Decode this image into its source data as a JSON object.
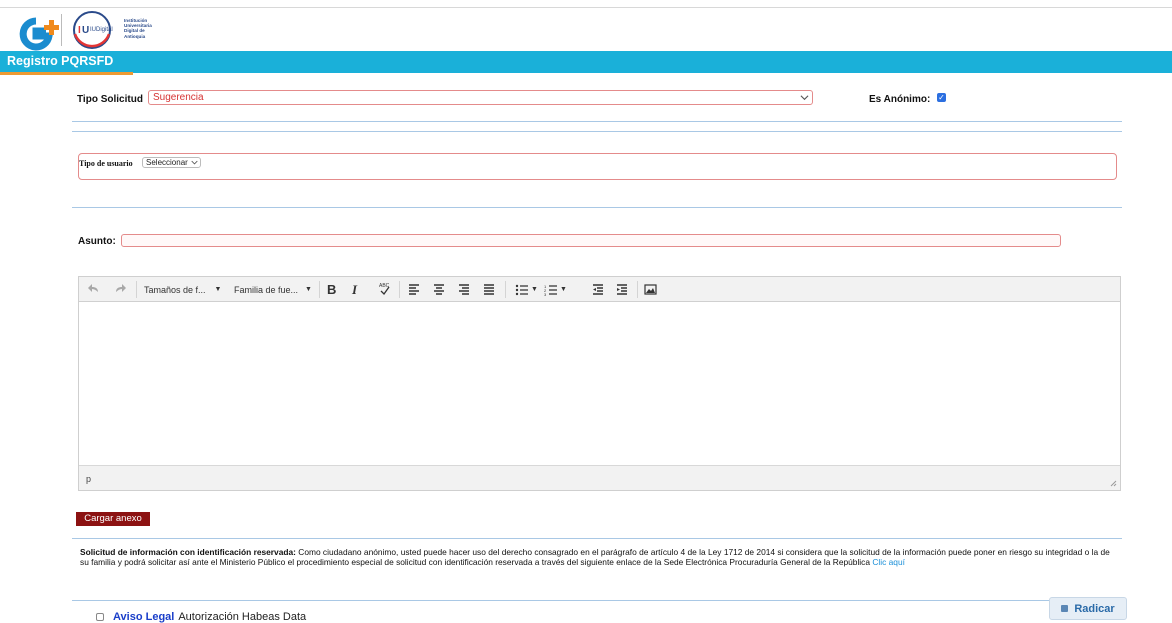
{
  "header": {
    "title": "Registro PQRSFD",
    "iu_logo_text": "IUDigital",
    "iu_name": "Institución\nUniversitaria\nDigital de\nAntioquia"
  },
  "form": {
    "tipo_solicitud_label": "Tipo Solicitud",
    "tipo_solicitud_value": "Sugerencia",
    "anonimo_label": "Es Anónimo:",
    "anonimo_checked": true,
    "tipo_usuario_label": "Tipo de usuario",
    "tipo_usuario_value": "Seleccionar",
    "asunto_label": "Asunto:",
    "asunto_value": ""
  },
  "editor": {
    "toolbar": {
      "font_size": "Tamaños de f...",
      "font_family": "Familia de fue...",
      "bold": "B",
      "italic": "I"
    },
    "status_path": "p"
  },
  "anexo_button": "Cargar anexo",
  "notice": {
    "title": "Solicitud de información con identificación reservada:",
    "body": " Como ciudadano anónimo, usted puede hacer uso del derecho consagrado en el parágrafo de artículo 4 de la Ley 1712 de 2014 si  considera que la solicitud de la información puede poner en riesgo su integridad o la de su familia y podrá solicitar así  ante el Ministerio Público el procedimiento especial de solicitud con identificación reservada a través del siguiente enlace de la Sede Electrónica Procuraduría General de la República ",
    "link": "Clic aquí"
  },
  "legal": {
    "aviso": "Aviso Legal",
    "habeas": "Autorización Habeas Data",
    "checked": false
  },
  "radicar_button": "Radicar",
  "colors": {
    "title_bar": "#1ab0d9",
    "accent_orange": "#ee9a33",
    "anexo_button": "#8c1212",
    "error_border": "#e48b8b",
    "link": "#1a8fd8"
  }
}
